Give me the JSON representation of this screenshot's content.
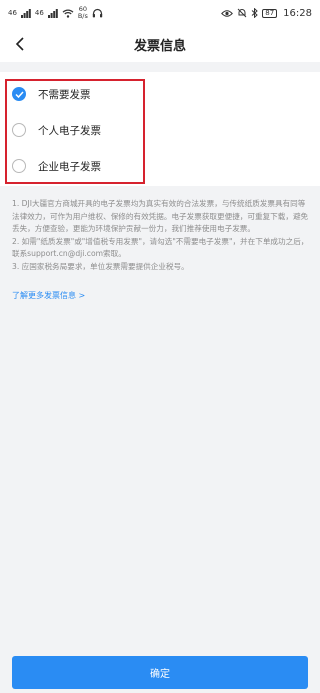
{
  "status_bar": {
    "signal_left": "46",
    "signal_right": "46",
    "speed_value": "60",
    "speed_unit": "B/s",
    "battery": "87",
    "time": "16:28"
  },
  "header": {
    "title": "发票信息"
  },
  "options": [
    {
      "label": "不需要发票",
      "selected": true
    },
    {
      "label": "个人电子发票",
      "selected": false
    },
    {
      "label": "企业电子发票",
      "selected": false
    }
  ],
  "notes": [
    "1. DJI大疆官方商城开具的电子发票均为真实有效的合法发票，与传统纸质发票具有同等法律效力，可作为用户维权、保修的有效凭据。电子发票获取更便捷，可重复下载，避免丢失，方便查验，更能为环境保护贡献一份力，我们推荐使用电子发票。",
    "2. 如需\"纸质发票\"或\"增值税专用发票\"，请勾选\"不需要电子发票\"，并在下单成功之后，联系support.cn@dji.com索取。",
    "3. 应国家税务局要求，单位发票需要提供企业税号。"
  ],
  "more_link": "了解更多发票信息 >",
  "confirm_label": "确定",
  "colors": {
    "accent": "#2a8cf3",
    "highlight": "#d6222e",
    "background": "#f2f3f5"
  }
}
